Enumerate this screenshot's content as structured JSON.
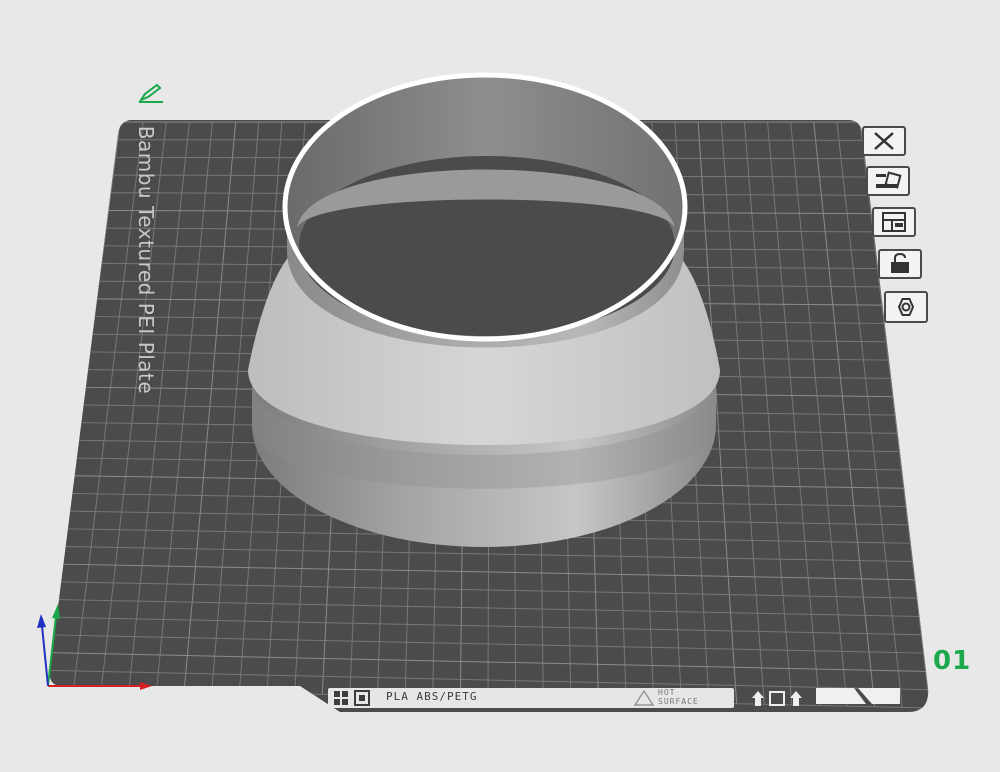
{
  "plate": {
    "label": "Bambu Textured PEI Plate",
    "number": "01",
    "footer_text": "PLA ABS/PETG",
    "hot_surface_line1": "HOT",
    "hot_surface_line2": "SURFACE"
  },
  "toolbar": {
    "items": [
      {
        "name": "delete-plate-button",
        "icon": "close-icon"
      },
      {
        "name": "auto-orient-button",
        "icon": "auto-orient-icon"
      },
      {
        "name": "arrange-button",
        "icon": "arrange-icon"
      },
      {
        "name": "lock-plate-button",
        "icon": "lock-icon"
      },
      {
        "name": "plate-settings-button",
        "icon": "settings-hex-icon"
      }
    ]
  },
  "colors": {
    "background": "#e8e8e8",
    "plate": "#4a4b4a",
    "grid": "#6e706e",
    "model_light": "#c9c9c9",
    "model_dark": "#7e7e7e",
    "accent_green": "#1aa84a",
    "axis_x": "#d42020",
    "axis_y": "#1aa84a",
    "axis_z": "#2030c0"
  }
}
